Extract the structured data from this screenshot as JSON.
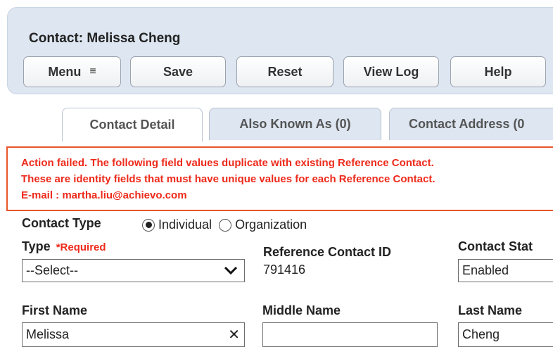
{
  "header": {
    "title": "Contact: Melissa Cheng",
    "menu_label": "Menu",
    "menu_icon": "≡",
    "save_label": "Save",
    "reset_label": "Reset",
    "viewlog_label": "View Log",
    "help_label": "Help"
  },
  "tabs": [
    {
      "label": "Contact Detail",
      "active": true
    },
    {
      "label": "Also Known As (0)",
      "active": false
    },
    {
      "label": "Contact Address (0",
      "active": false
    }
  ],
  "error": {
    "line1": "Action failed. The following field values duplicate with existing Reference Contact.",
    "line2": "These are identity fields that must have unique values for each Reference Contact.",
    "line3": "E-mail : martha.liu@achievo.com",
    "color": "#ee2a1b"
  },
  "form": {
    "contact_type_label": "Contact Type",
    "contact_type_options": [
      "Individual",
      "Organization"
    ],
    "contact_type_selected": "Individual",
    "type_label": "Type",
    "type_required": "*Required",
    "type_value": "--Select--",
    "ref_id_label": "Reference Contact ID",
    "ref_id_value": "791416",
    "status_label": "Contact Stat",
    "status_value": "Enabled",
    "first_name_label": "First Name",
    "first_name_value": "Melissa",
    "middle_name_label": "Middle Name",
    "middle_name_value": "",
    "last_name_label": "Last Name",
    "last_name_value": "Cheng"
  },
  "colors": {
    "header_bg": "#dde6f1",
    "error_border": "#e8562a"
  }
}
